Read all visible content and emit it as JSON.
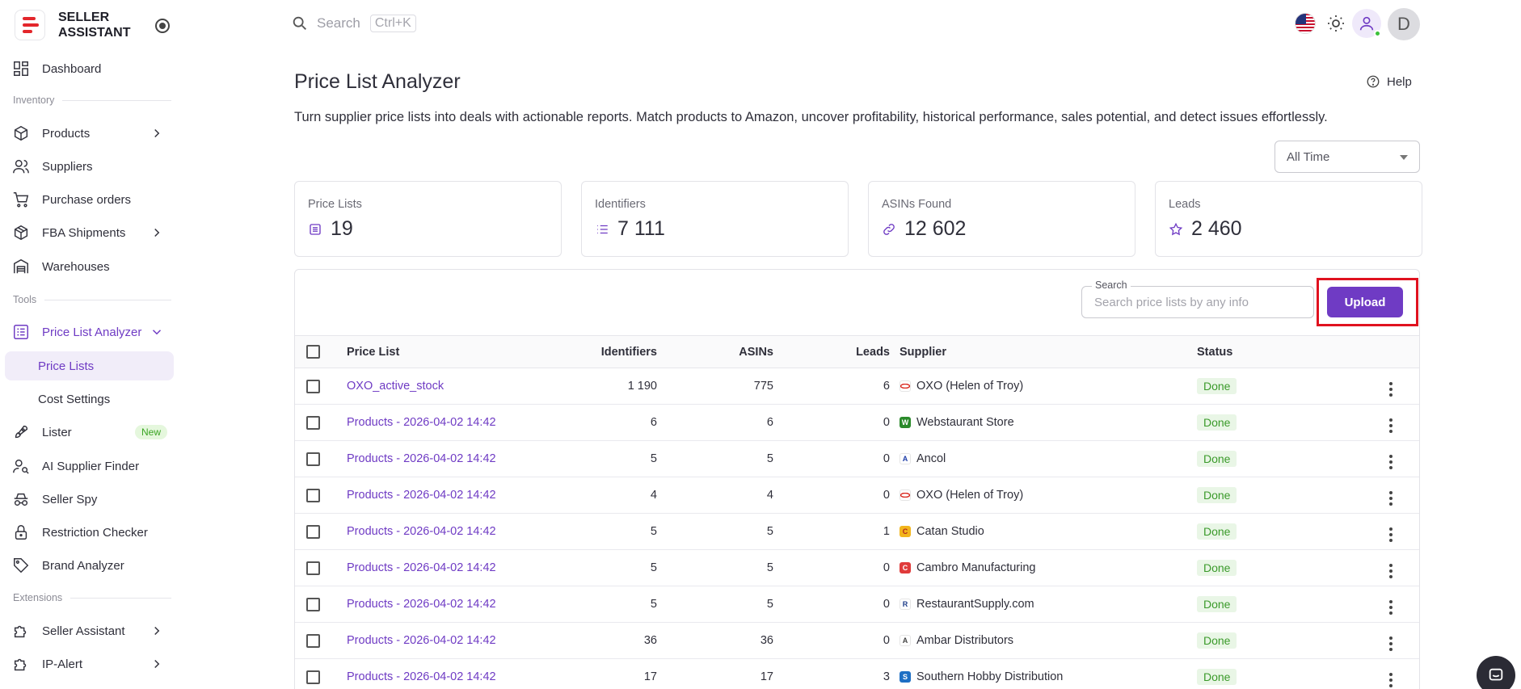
{
  "brand": {
    "line1": "SELLER",
    "line2": "ASSISTANT"
  },
  "sidebar": {
    "dashboard": "Dashboard",
    "section_inventory": "Inventory",
    "products": "Products",
    "suppliers": "Suppliers",
    "purchase_orders": "Purchase orders",
    "fba_shipments": "FBA Shipments",
    "warehouses": "Warehouses",
    "section_tools": "Tools",
    "price_list_analyzer": "Price List Analyzer",
    "price_lists": "Price Lists",
    "cost_settings": "Cost Settings",
    "lister": "Lister",
    "lister_badge": "New",
    "ai_supplier_finder": "AI Supplier Finder",
    "seller_spy": "Seller Spy",
    "restriction_checker": "Restriction Checker",
    "brand_analyzer": "Brand Analyzer",
    "section_extensions": "Extensions",
    "seller_assistant": "Seller Assistant",
    "ip_alert": "IP-Alert"
  },
  "topbar": {
    "search_placeholder": "Search",
    "shortcut": "Ctrl+K",
    "avatar_letter": "D"
  },
  "page": {
    "title": "Price List Analyzer",
    "help": "Help",
    "description": "Turn supplier price lists into deals with actionable reports. Match products to Amazon, uncover profitability, historical performance, sales potential, and detect issues effortlessly.",
    "time_filter": "All Time"
  },
  "stats": {
    "price_lists": {
      "label": "Price Lists",
      "value": "19"
    },
    "identifiers": {
      "label": "Identifiers",
      "value": "7 111"
    },
    "asins": {
      "label": "ASINs Found",
      "value": "12 602"
    },
    "leads": {
      "label": "Leads",
      "value": "2 460"
    }
  },
  "table": {
    "search_label": "Search",
    "search_placeholder": "Search price lists by any info",
    "upload_label": "Upload",
    "headers": {
      "price_list": "Price List",
      "identifiers": "Identifiers",
      "asins": "ASINs",
      "leads": "Leads",
      "supplier": "Supplier",
      "status": "Status"
    },
    "rows": [
      {
        "name": "OXO_active_stock",
        "identifiers": "1 190",
        "asins": "775",
        "leads": "6",
        "supplier": "OXO (Helen of Troy)",
        "status": "Done"
      },
      {
        "name": "Products - 2026-04-02 14:42",
        "identifiers": "6",
        "asins": "6",
        "leads": "0",
        "supplier": "Webstaurant Store",
        "status": "Done"
      },
      {
        "name": "Products - 2026-04-02 14:42",
        "identifiers": "5",
        "asins": "5",
        "leads": "0",
        "supplier": "Ancol",
        "status": "Done"
      },
      {
        "name": "Products - 2026-04-02 14:42",
        "identifiers": "4",
        "asins": "4",
        "leads": "0",
        "supplier": "OXO (Helen of Troy)",
        "status": "Done"
      },
      {
        "name": "Products - 2026-04-02 14:42",
        "identifiers": "5",
        "asins": "5",
        "leads": "1",
        "supplier": "Catan Studio",
        "status": "Done"
      },
      {
        "name": "Products - 2026-04-02 14:42",
        "identifiers": "5",
        "asins": "5",
        "leads": "0",
        "supplier": "Cambro Manufacturing",
        "status": "Done"
      },
      {
        "name": "Products - 2026-04-02 14:42",
        "identifiers": "5",
        "asins": "5",
        "leads": "0",
        "supplier": "RestaurantSupply.com",
        "status": "Done"
      },
      {
        "name": "Products - 2026-04-02 14:42",
        "identifiers": "36",
        "asins": "36",
        "leads": "0",
        "supplier": "Ambar Distributors",
        "status": "Done"
      },
      {
        "name": "Products - 2026-04-02 14:42",
        "identifiers": "17",
        "asins": "17",
        "leads": "3",
        "supplier": "Southern Hobby Distribution",
        "status": "Done"
      }
    ]
  },
  "colors": {
    "accent": "#6f3bc4",
    "brand_red": "#e3262b",
    "highlight": "#e0121f",
    "status_green": "#3a9a2a"
  }
}
